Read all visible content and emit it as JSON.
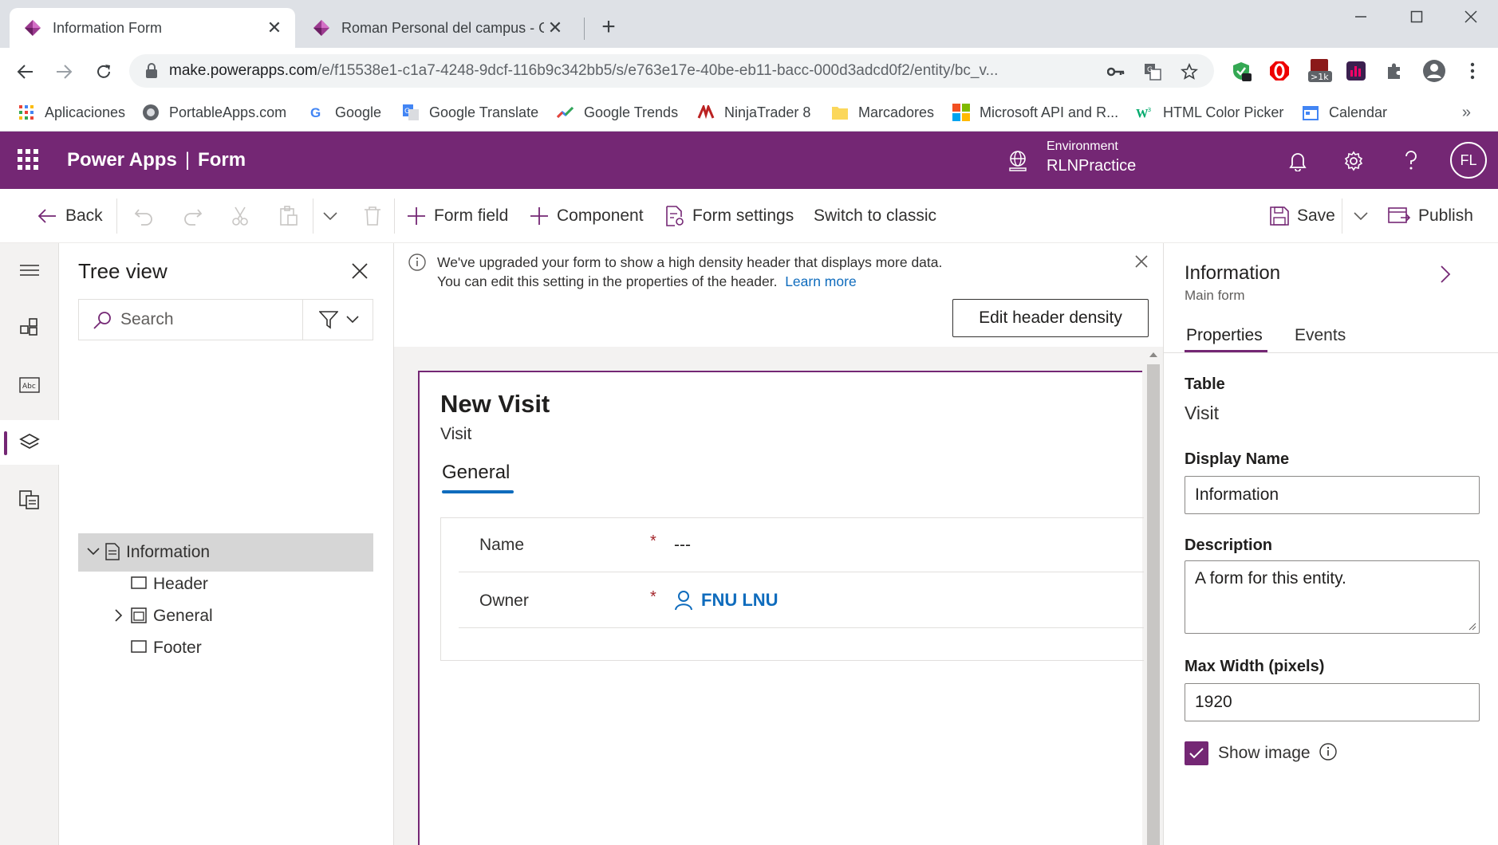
{
  "browser": {
    "tabs": [
      {
        "title": "Information Form",
        "active": true
      },
      {
        "title": "Roman Personal del campus - Gu",
        "active": false
      }
    ],
    "url_host": "make.powerapps.com",
    "url_path": "/e/f15538e1-c1a7-4248-9dcf-116b9c342bb5/s/e763e17e-40be-eb11-bacc-000d3adcd0f2/entity/bc_v...",
    "ext_badge": ">1k",
    "bookmarks": [
      {
        "label": "Aplicaciones",
        "icon": "apps-grid-icon"
      },
      {
        "label": "PortableApps.com",
        "icon": "portableapps-icon"
      },
      {
        "label": "Google",
        "icon": "google-icon"
      },
      {
        "label": "Google Translate",
        "icon": "translate-icon"
      },
      {
        "label": "Google Trends",
        "icon": "trends-icon"
      },
      {
        "label": "NinjaTrader 8",
        "icon": "ninjatrader-icon"
      },
      {
        "label": "Marcadores",
        "icon": "folder-icon"
      },
      {
        "label": "Microsoft API and R...",
        "icon": "microsoft-icon"
      },
      {
        "label": "HTML Color Picker",
        "icon": "w3-icon"
      },
      {
        "label": "Calendar",
        "icon": "calendar-icon"
      }
    ],
    "more_bookmarks": "»"
  },
  "app": {
    "name": "Power Apps",
    "separator": "|",
    "page": "Form",
    "environment_label": "Environment",
    "environment_name": "RLNPractice",
    "avatar_initials": "FL",
    "accent_color": "#742774"
  },
  "commandbar": {
    "back": "Back",
    "form_field": "Form field",
    "component": "Component",
    "form_settings": "Form settings",
    "switch_classic": "Switch to classic",
    "save": "Save",
    "publish": "Publish"
  },
  "tree": {
    "title": "Tree view",
    "search_placeholder": "Search",
    "items": [
      {
        "label": "Information"
      },
      {
        "label": "Header"
      },
      {
        "label": "General"
      },
      {
        "label": "Footer"
      }
    ]
  },
  "banner": {
    "text": "We've upgraded your form to show a high density header that displays more data. You can edit this setting in the properties of the header.",
    "link": "Learn more",
    "button": "Edit header density"
  },
  "form": {
    "title": "New Visit",
    "subtitle": "Visit",
    "tab": "General",
    "fields": [
      {
        "label": "Name",
        "required": "*",
        "value": "---"
      },
      {
        "label": "Owner",
        "required": "*",
        "value": "FNU LNU"
      }
    ]
  },
  "properties": {
    "title": "Information",
    "subtitle": "Main form",
    "tabs": [
      "Properties",
      "Events"
    ],
    "table_label": "Table",
    "table_value": "Visit",
    "display_name_label": "Display Name",
    "display_name_value": "Information",
    "description_label": "Description",
    "description_value": "A form for this entity.",
    "max_width_label": "Max Width (pixels)",
    "max_width_value": "1920",
    "show_image_label": "Show image",
    "show_image_checked": true
  }
}
